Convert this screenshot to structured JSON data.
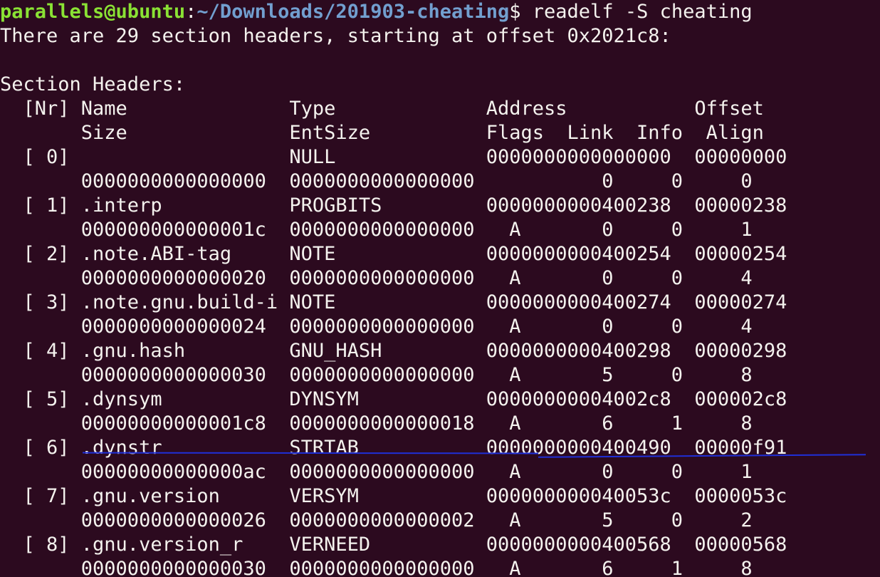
{
  "terminal": {
    "prompt": {
      "user_host": "parallels@ubuntu",
      "path": "~/Downloads/201903-cheating",
      "symbol": "$ ",
      "command": "readelf -S cheating"
    },
    "intro": "There are 29 section headers, starting at offset 0x2021c8:",
    "blank": "",
    "section_title": "Section Headers:",
    "header_row1": "  [Nr] Name              Type             Address           Offset",
    "header_row2": "       Size              EntSize          Flags  Link  Info  Align",
    "rows": [
      "  [ 0]                   NULL             0000000000000000  00000000",
      "       0000000000000000  0000000000000000           0     0     0",
      "  [ 1] .interp           PROGBITS         0000000000400238  00000238",
      "       000000000000001c  0000000000000000   A       0     0     1",
      "  [ 2] .note.ABI-tag     NOTE             0000000000400254  00000254",
      "       0000000000000020  0000000000000000   A       0     0     4",
      "  [ 3] .note.gnu.build-i NOTE             0000000000400274  00000274",
      "       0000000000000024  0000000000000000   A       0     0     4",
      "  [ 4] .gnu.hash         GNU_HASH         0000000000400298  00000298",
      "       0000000000000030  0000000000000000   A       5     0     8",
      "  [ 5] .dynsym           DYNSYM           00000000004002c8  000002c8",
      "       00000000000001c8  0000000000000018   A       6     1     8",
      "  [ 6] .dynstr           STRTAB           0000000000400490  00000f91",
      "       00000000000000ac  0000000000000000   A       0     0     1",
      "  [ 7] .gnu.version      VERSYM           000000000040053c  0000053c",
      "       0000000000000026  0000000000000002   A       5     0     2",
      "  [ 8] .gnu.version_r    VERNEED          0000000000400568  00000568",
      "       0000000000000030  0000000000000000   A       6     1     8"
    ],
    "colors": {
      "background": "#2c0a1f",
      "text": "#f4f2ee",
      "user_host": "#8ae234",
      "path": "#729fcf",
      "annotation": "#1f2fd8"
    }
  }
}
